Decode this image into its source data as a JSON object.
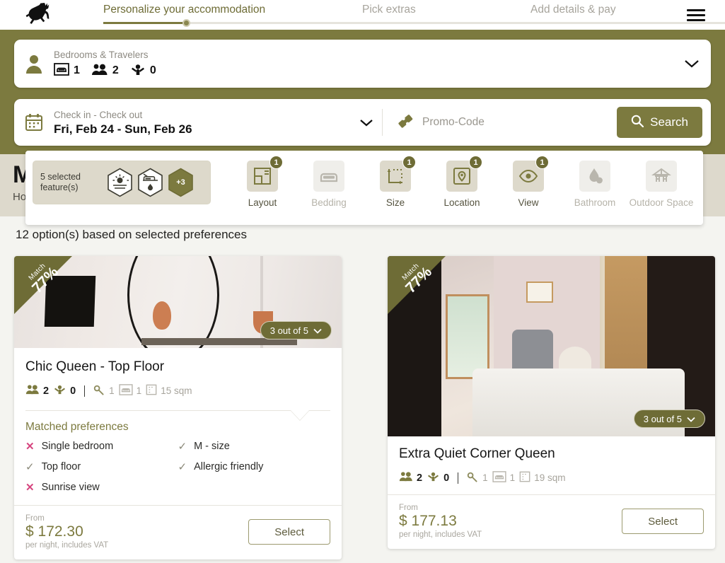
{
  "header": {
    "logo_icon": "deer-logo-icon",
    "menu_icon": "hamburger-menu-icon",
    "steps": [
      {
        "label": "Personalize your accommodation",
        "active": true
      },
      {
        "label": "Pick extras",
        "active": false
      },
      {
        "label": "Add details & pay",
        "active": false
      }
    ],
    "progress_percent": 11
  },
  "search": {
    "occupancy": {
      "user_icon": "person-icon",
      "label": "Bedrooms & Travelers",
      "bedrooms_icon": "bed-icon",
      "bedrooms": "1",
      "adults_icon": "adults-icon",
      "adults": "2",
      "children_icon": "child-icon",
      "children": "0",
      "chevron_icon": "chevron-down-icon"
    },
    "dates": {
      "calendar_icon": "calendar-icon",
      "label": "Check in - Check out",
      "value": "Fri, Feb 24 - Sun, Feb 26",
      "chevron_icon": "chevron-down-icon"
    },
    "promo": {
      "ticket_icon": "promo-ticket-icon",
      "placeholder": "Promo-Code",
      "value": ""
    },
    "search_button": {
      "label": "Search",
      "icon": "search-icon"
    }
  },
  "hero_behind": {
    "title": "M",
    "subtitle": "Ho"
  },
  "filters": {
    "selected_chip": {
      "label": "5 selected feature(s)",
      "badges": [
        {
          "icon": "sunrise-view-hex-icon",
          "text": ""
        },
        {
          "icon": "bed-allergic-hex-icon",
          "text": ""
        },
        {
          "icon": "more-hex-icon",
          "text": "+3"
        }
      ]
    },
    "items": [
      {
        "label": "Layout",
        "icon": "layout-icon",
        "count": "1",
        "active": true
      },
      {
        "label": "Bedding",
        "icon": "bedding-icon",
        "count": "",
        "active": false
      },
      {
        "label": "Size",
        "icon": "size-icon",
        "count": "1",
        "active": true
      },
      {
        "label": "Location",
        "icon": "location-pin-icon",
        "count": "1",
        "active": true
      },
      {
        "label": "View",
        "icon": "eye-view-icon",
        "count": "1",
        "active": true
      },
      {
        "label": "Bathroom",
        "icon": "water-drop-icon",
        "count": "",
        "active": false
      },
      {
        "label": "Outdoor Space",
        "icon": "outdoor-space-icon",
        "count": "",
        "active": false
      }
    ]
  },
  "results": {
    "count_text": "12 option(s) based on selected preferences",
    "cards": [
      {
        "match_label": "Match",
        "match_value": "77%",
        "image_counter": "3 out of 5",
        "image_counter_icon": "chevron-down-icon",
        "title": "Chic Queen - Top Floor",
        "meta": {
          "adults_icon": "adults-icon",
          "adults": "2",
          "children_icon": "child-icon",
          "children": "0",
          "key_icon": "key-icon",
          "keys": "1",
          "bed_icon": "bed-icon",
          "beds": "1",
          "area_icon": "area-icon",
          "area": "15 sqm"
        },
        "matched_title": "Matched preferences",
        "preferences": [
          {
            "label": "Single bedroom",
            "matched": false
          },
          {
            "label": "M - size",
            "matched": true
          },
          {
            "label": "Top floor",
            "matched": true
          },
          {
            "label": "Allergic friendly",
            "matched": true
          },
          {
            "label": "Sunrise view",
            "matched": false
          }
        ],
        "price": {
          "from_label": "From",
          "amount": "$ 172.30",
          "note": "per night, includes VAT"
        },
        "select_label": "Select"
      },
      {
        "match_label": "Match",
        "match_value": "77%",
        "image_counter": "3 out of 5",
        "image_counter_icon": "chevron-down-icon",
        "title": "Extra Quiet Corner Queen",
        "meta": {
          "adults_icon": "adults-icon",
          "adults": "2",
          "children_icon": "child-icon",
          "children": "0",
          "key_icon": "key-icon",
          "keys": "1",
          "bed_icon": "bed-icon",
          "beds": "1",
          "area_icon": "area-icon",
          "area": "19 sqm"
        },
        "price": {
          "from_label": "From",
          "amount": "$ 177.13",
          "note": "per night, includes VAT"
        },
        "select_label": "Select"
      }
    ]
  },
  "colors": {
    "brand_olive": "#7c7a3f",
    "badge_olive": "#6e6c36",
    "chip_bg": "#ddd9cb",
    "x_mark": "#d6457f"
  }
}
